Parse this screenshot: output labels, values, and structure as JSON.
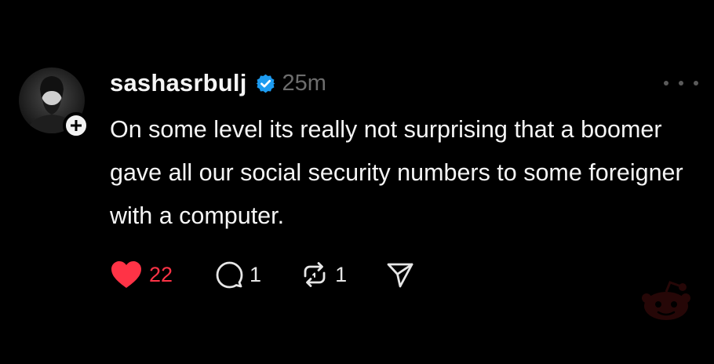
{
  "post": {
    "username": "sashasrbulj",
    "timestamp": "25m",
    "text": "On some level its really not surprising that a boomer gave all our social security numbers to some foreigner with a computer.",
    "verified": true
  },
  "actions": {
    "likes": "22",
    "replies": "1",
    "reposts": "1"
  },
  "colors": {
    "background": "#000000",
    "text": "#f5f5f5",
    "muted": "#6d6d6d",
    "like": "#ff3346",
    "verified": "#1d9bf0"
  },
  "icons": [
    "avatar",
    "plus-icon",
    "verified-badge-icon",
    "more-dots-icon",
    "heart-icon",
    "reply-icon",
    "repost-icon",
    "share-icon",
    "reddit-watermark-icon"
  ]
}
